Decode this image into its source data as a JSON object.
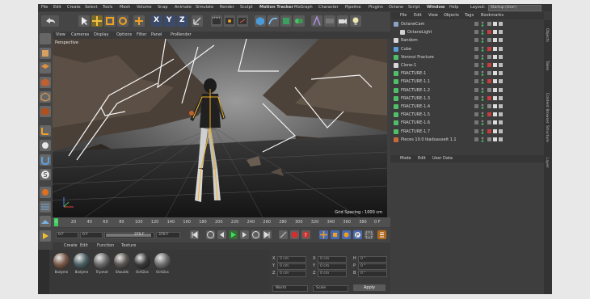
{
  "app": {
    "layout_label": "Layout:",
    "layout_value": "Startup (User)"
  },
  "menubar": [
    "File",
    "Edit",
    "Create",
    "Select",
    "Tools",
    "Mesh",
    "Volume",
    "Snap",
    "Animate",
    "Simulate",
    "Render",
    "Sculpt",
    "Motion Tracker",
    "MoGraph",
    "Character",
    "Pipeline",
    "Plugins",
    "Octane",
    "Script",
    "Window",
    "Help"
  ],
  "toolbar": {
    "axis_labels": [
      "X",
      "Y",
      "Z"
    ]
  },
  "viewport": {
    "menu": [
      "View",
      "Cameras",
      "Display",
      "Options",
      "Filter",
      "Panel",
      "ProRender"
    ],
    "name": "Perspective",
    "grid_spacing": "Grid Spacing : 1000 cm"
  },
  "timeline": {
    "ticks": [
      "0",
      "20",
      "40",
      "60",
      "80",
      "100",
      "120",
      "140",
      "160",
      "180",
      "200",
      "220",
      "240",
      "260",
      "280",
      "300",
      "320",
      "340",
      "360",
      "380"
    ],
    "frame_end": "0 F"
  },
  "transport": {
    "start": "0 F",
    "current": "0 F",
    "end": "370 F",
    "max": "370 F"
  },
  "material_manager": {
    "menu": [
      "Create",
      "Edit",
      "Function",
      "Texture"
    ],
    "materials": [
      {
        "name": "Bodyme",
        "color": "#7a5a48"
      },
      {
        "name": "Bodyme",
        "color": "#4c6064"
      },
      {
        "name": "Tripmat",
        "color": "#6a6a6a"
      },
      {
        "name": "Shoulde",
        "color": "#5a5752"
      },
      {
        "name": "OctGlos",
        "color": "#3a3a3a"
      },
      {
        "name": "OctGlos",
        "color": "#6e6e6e"
      }
    ]
  },
  "coordinates": {
    "rows": [
      {
        "a": "X",
        "a_val": "0 cm",
        "b": "X",
        "b_val": "0 cm",
        "c": "H",
        "c_val": "0 °"
      },
      {
        "a": "Y",
        "a_val": "0 cm",
        "b": "Y",
        "b_val": "0 cm",
        "c": "P",
        "c_val": "0 °"
      },
      {
        "a": "Z",
        "a_val": "0 cm",
        "b": "Z",
        "b_val": "0 cm",
        "c": "B",
        "c_val": "0 °"
      }
    ],
    "mode1": "World",
    "mode2": "Scale",
    "apply": "Apply"
  },
  "object_manager": {
    "menu": [
      "File",
      "Edit",
      "View",
      "Objects",
      "Tags",
      "Bookmarks"
    ],
    "objects": [
      {
        "name": "OctaneCam",
        "indent": 0,
        "icon": "#8aa4c8"
      },
      {
        "name": "OctaneLight",
        "indent": 8,
        "icon": "#cfcfcf"
      },
      {
        "name": "Random",
        "indent": 0,
        "icon": "#d8d8d8"
      },
      {
        "name": "Cube",
        "indent": 0,
        "icon": "#5aa0d8"
      },
      {
        "name": "Voronoi Fracture",
        "indent": 0,
        "icon": "#4fbf6a"
      },
      {
        "name": "Clone-1",
        "indent": 0,
        "icon": "#d8d8d8"
      },
      {
        "name": "FRACTURE-1",
        "indent": 0,
        "icon": "#4fbf6a"
      },
      {
        "name": "FRACTURE-1.1",
        "indent": 0,
        "icon": "#4fbf6a"
      },
      {
        "name": "FRACTURE-1.2",
        "indent": 0,
        "icon": "#4fbf6a"
      },
      {
        "name": "FRACTURE-1.3",
        "indent": 0,
        "icon": "#4fbf6a"
      },
      {
        "name": "FRACTURE-1.4",
        "indent": 0,
        "icon": "#4fbf6a"
      },
      {
        "name": "FRACTURE-1.5",
        "indent": 0,
        "icon": "#4fbf6a"
      },
      {
        "name": "FRACTURE-1.6",
        "indent": 0,
        "icon": "#4fbf6a"
      },
      {
        "name": "FRACTURE-1.7",
        "indent": 0,
        "icon": "#4fbf6a"
      },
      {
        "name": "Pieces 10.0 Ikaduauseit 1.1",
        "indent": 0,
        "icon": "#c86a3a"
      }
    ]
  },
  "attribute_manager": {
    "menu": [
      "Mode",
      "Edit",
      "User Data"
    ]
  },
  "side_tabs": [
    "Objects",
    "Takes",
    "Content Browser",
    "Structure",
    "Layer"
  ],
  "colors": {
    "accent": "#f0a020",
    "panel": "#3c3c3c",
    "viewport_bg": "#1b1b1b"
  }
}
